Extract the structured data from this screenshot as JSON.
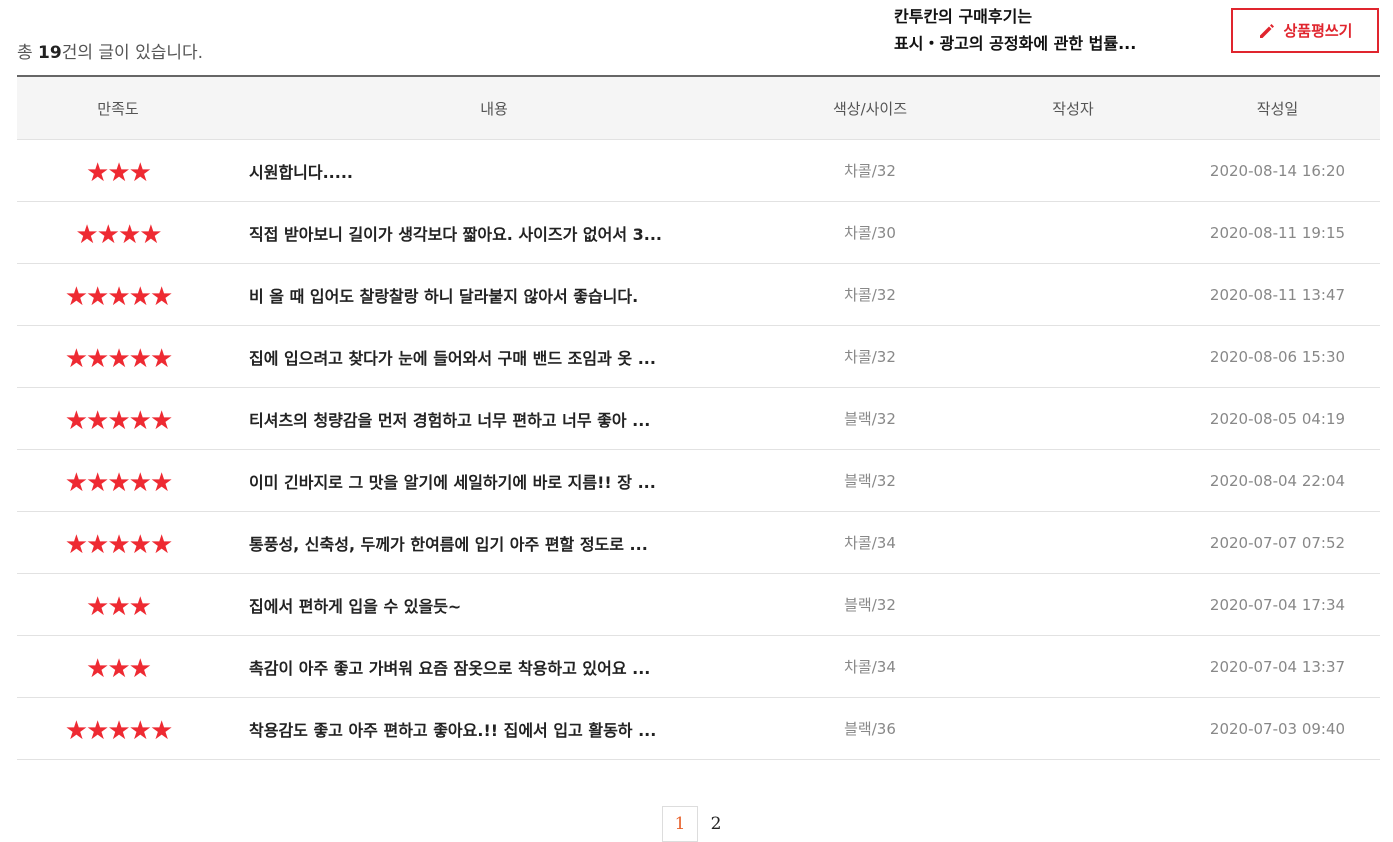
{
  "summary": {
    "prefix": "총 ",
    "count": "19",
    "suffix": "건의 글이 있습니다."
  },
  "notice": {
    "line1": "칸투칸의 구매후기는",
    "line2": "표시・광고의 공정화에 관한 법률..."
  },
  "write_button": {
    "label": "상품평쓰기",
    "icon": "pencil-icon"
  },
  "colors": {
    "accent": "#e0252e",
    "star": "#ee2a32",
    "active_page": "#e8622c"
  },
  "table": {
    "headers": {
      "rating": "만족도",
      "content": "내용",
      "option": "색상/사이즈",
      "writer": "작성자",
      "date": "작성일"
    },
    "rows": [
      {
        "rating": 3,
        "stars": "★★★",
        "content": "시원합니다.....",
        "option": "차콜/32",
        "writer": "",
        "date": "2020-08-14 16:20"
      },
      {
        "rating": 4,
        "stars": "★★★★",
        "content": "직접 받아보니 길이가 생각보다 짧아요. 사이즈가 없어서 3...",
        "option": "차콜/30",
        "writer": "",
        "date": "2020-08-11 19:15"
      },
      {
        "rating": 5,
        "stars": "★★★★★",
        "content": "비 올 때 입어도 찰랑찰랑 하니 달라붙지 않아서 좋습니다.",
        "option": "차콜/32",
        "writer": "",
        "date": "2020-08-11 13:47"
      },
      {
        "rating": 5,
        "stars": "★★★★★",
        "content": "집에 입으려고 찾다가 눈에 들어와서 구매 밴드 조임과 옷 ...",
        "option": "차콜/32",
        "writer": "",
        "date": "2020-08-06 15:30"
      },
      {
        "rating": 5,
        "stars": "★★★★★",
        "content": "티셔츠의 청량감을 먼저 경험하고 너무 편하고 너무 좋아 ...",
        "option": "블랙/32",
        "writer": "",
        "date": "2020-08-05 04:19"
      },
      {
        "rating": 5,
        "stars": "★★★★★",
        "content": "이미 긴바지로 그 맛을 알기에 세일하기에 바로 지름!! 장 ...",
        "option": "블랙/32",
        "writer": "",
        "date": "2020-08-04 22:04"
      },
      {
        "rating": 5,
        "stars": "★★★★★",
        "content": "통풍성, 신축성, 두께가 한여름에 입기 아주 편할 정도로 ...",
        "option": "차콜/34",
        "writer": "",
        "date": "2020-07-07 07:52"
      },
      {
        "rating": 3,
        "stars": "★★★",
        "content": "집에서 편하게 입을 수 있을듯~",
        "option": "블랙/32",
        "writer": "",
        "date": "2020-07-04 17:34"
      },
      {
        "rating": 3,
        "stars": "★★★",
        "content": "촉감이 아주 좋고 가벼워 요즘 잠옷으로 착용하고 있어요 ...",
        "option": "차콜/34",
        "writer": "",
        "date": "2020-07-04 13:37"
      },
      {
        "rating": 5,
        "stars": "★★★★★",
        "content": "착용감도 좋고 아주 편하고 좋아요.!! 집에서 입고 활동하 ...",
        "option": "블랙/36",
        "writer": "",
        "date": "2020-07-03 09:40"
      }
    ]
  },
  "pagination": {
    "pages": [
      "1",
      "2"
    ],
    "current": "1"
  }
}
